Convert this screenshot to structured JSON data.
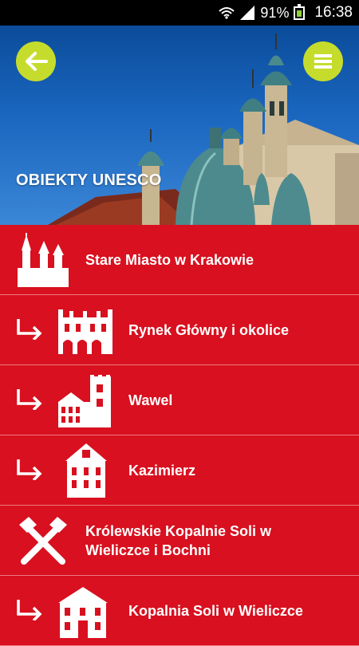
{
  "status_bar": {
    "battery_percent": "91%",
    "time": "16:38",
    "icons": [
      "wifi-icon",
      "signal-icon",
      "battery-icon"
    ]
  },
  "header": {
    "title": "OBIEKTY UNESCO",
    "back_icon": "back-arrow-icon",
    "menu_icon": "hamburger-menu-icon",
    "button_color": "#c6dc2c"
  },
  "list": {
    "background_color": "#d8101f",
    "items": [
      {
        "label": "Stare Miasto w Krakowie",
        "icon": "church-towers-icon",
        "level": "top"
      },
      {
        "label": "Rynek Główny i okolice",
        "icon": "cloth-hall-icon",
        "level": "sub"
      },
      {
        "label": "Wawel",
        "icon": "castle-icon",
        "level": "sub"
      },
      {
        "label": "Kazimierz",
        "icon": "tower-building-icon",
        "level": "sub"
      },
      {
        "label": "Królewskie Kopalnie Soli w Wieliczce i Bochni",
        "icon": "crossed-hammers-icon",
        "level": "top"
      },
      {
        "label": "Kopalnia Soli w Wieliczce",
        "icon": "mine-building-icon",
        "level": "sub"
      }
    ]
  }
}
